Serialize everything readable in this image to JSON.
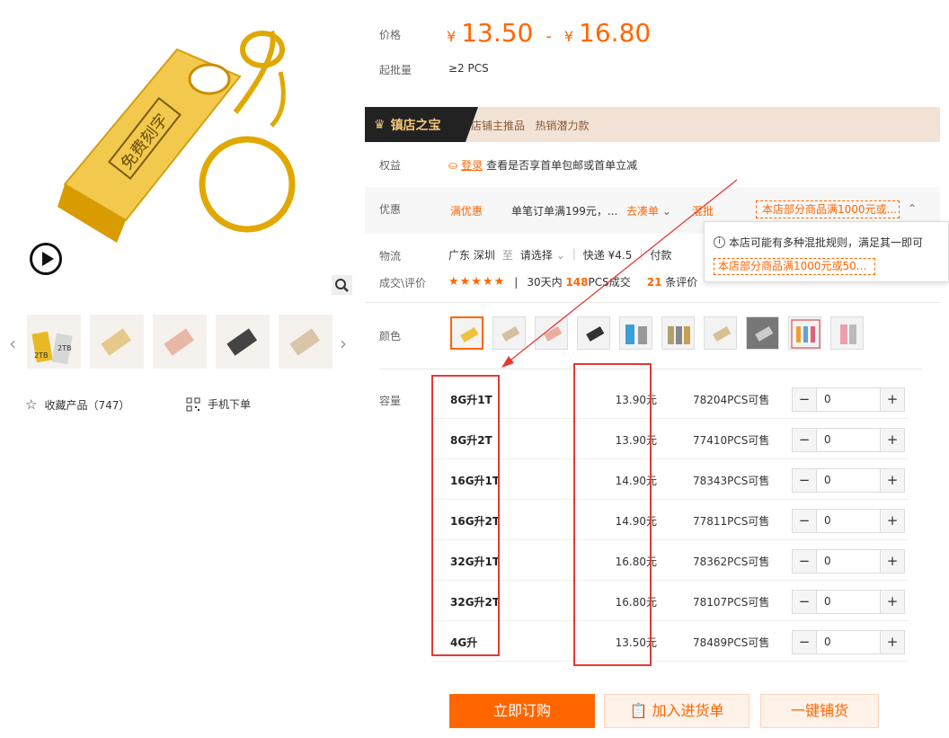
{
  "gallery": {
    "engrave_text": "免费刻字",
    "thumbs": [
      "thumb-1",
      "thumb-2",
      "thumb-3",
      "thumb-4",
      "thumb-5"
    ],
    "thumb1_label_a": "2TB",
    "thumb1_label_b": "2TB"
  },
  "actions": {
    "favorite_label": "收藏产品（747）",
    "mobile_order_label": "手机下单"
  },
  "price": {
    "label": "价格",
    "currency": "¥",
    "low": "13.50",
    "dash": "-",
    "high": "16.80",
    "min_batch_label": "起批量",
    "min_batch_value": "≥2 PCS"
  },
  "banner": {
    "badge": "镇店之宝",
    "text": "店铺主推品   热销潜力款"
  },
  "benefit": {
    "label": "权益",
    "login": "登录",
    "text": "查看是否享首单包邮或首单立减"
  },
  "promo": {
    "label": "优惠",
    "full_discount": "满优惠",
    "condition": "单笔订单满199元，...",
    "go_order": "去凑单",
    "mixed": "混批",
    "mixed_rule": "本店部分商品满1000元或..."
  },
  "popover": {
    "info": "本店可能有多种混批规则，满足其一即可",
    "rule": "本店部分商品满1000元或50..."
  },
  "shipping": {
    "label": "物流",
    "from": "广东 深圳",
    "to_word": "至",
    "to": "请选择",
    "express": "快递 ¥4.5",
    "pay": "付款"
  },
  "deal": {
    "label": "成交\\评价",
    "stars": "★★★★★",
    "sold_prefix": "30天内",
    "sold_count": "148",
    "sold_suffix": "PCS成交",
    "review_count": "21",
    "review_suffix": "条评价"
  },
  "color": {
    "label": "颜色",
    "swatch_count": 10
  },
  "capacity": {
    "label": "容量",
    "rows": [
      {
        "name": "8G升1T",
        "price": "13.90元",
        "stock": "78204PCS可售",
        "qty": "0"
      },
      {
        "name": "8G升2T",
        "price": "13.90元",
        "stock": "77410PCS可售",
        "qty": "0"
      },
      {
        "name": "16G升1T",
        "price": "14.90元",
        "stock": "78343PCS可售",
        "qty": "0"
      },
      {
        "name": "16G升2T",
        "price": "14.90元",
        "stock": "77811PCS可售",
        "qty": "0"
      },
      {
        "name": "32G升1T",
        "price": "16.80元",
        "stock": "78362PCS可售",
        "qty": "0"
      },
      {
        "name": "32G升2T",
        "price": "16.80元",
        "stock": "78107PCS可售",
        "qty": "0"
      },
      {
        "name": "4G升",
        "price": "13.50元",
        "stock": "78489PCS可售",
        "qty": "0"
      }
    ]
  },
  "buttons": {
    "buy": "立即订购",
    "cart": "加入进货单",
    "distribute": "一键铺货"
  },
  "colors": {
    "accent": "#ff6600",
    "annotation": "#e53935"
  }
}
